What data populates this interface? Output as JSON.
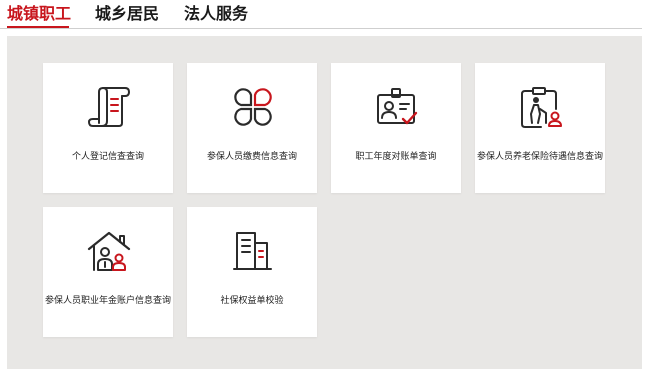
{
  "tabs": [
    {
      "label": "城镇职工",
      "active": true
    },
    {
      "label": "城乡居民",
      "active": false
    },
    {
      "label": "法人服务",
      "active": false
    }
  ],
  "services": [
    {
      "label": "个人登记信查查询",
      "icon": "scroll-document-icon"
    },
    {
      "label": "参保人员缴费信息查询",
      "icon": "four-leaf-clover-icon"
    },
    {
      "label": "职工年度对账单查询",
      "icon": "id-card-check-icon"
    },
    {
      "label": "参保人员养老保险待遇信息查询",
      "icon": "elderly-clipboard-icon"
    },
    {
      "label": "参保人员职业年金账户信息查询",
      "icon": "house-people-icon"
    },
    {
      "label": "社保权益单校验",
      "icon": "buildings-icon"
    }
  ],
  "colors": {
    "accent": "#c8161d",
    "icon_dark": "#2b2b2b",
    "panel_bg": "#e8e7e5"
  }
}
